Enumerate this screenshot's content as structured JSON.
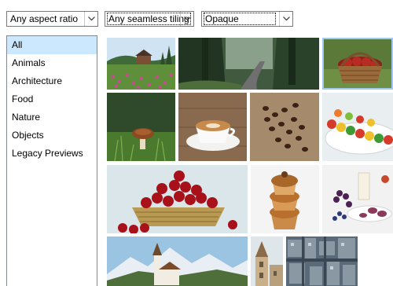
{
  "filters": {
    "aspect_ratio": {
      "selected": "Any aspect ratio"
    },
    "tiling": {
      "selected": "Any seamless tiling"
    },
    "opacity": {
      "selected": "Opaque"
    }
  },
  "categories": [
    {
      "label": "All",
      "selected": true
    },
    {
      "label": "Animals"
    },
    {
      "label": "Architecture"
    },
    {
      "label": "Food"
    },
    {
      "label": "Nature"
    },
    {
      "label": "Objects"
    },
    {
      "label": "Legacy Previews"
    }
  ],
  "thumbnails": [
    {
      "subject": "meadow-farmhouse"
    },
    {
      "subject": "forest-road"
    },
    {
      "subject": "apple-basket"
    },
    {
      "subject": "mushroom"
    },
    {
      "subject": "latte-cup"
    },
    {
      "subject": "coffee-beans"
    },
    {
      "subject": "vegetable-skewers"
    },
    {
      "subject": "cherry-basket"
    },
    {
      "subject": "muffin-stack"
    },
    {
      "subject": "breakfast-table"
    },
    {
      "subject": "alpine-church"
    },
    {
      "subject": "church-tower"
    },
    {
      "subject": "city-aerial"
    }
  ],
  "colors": {
    "selection": "#cce8ff",
    "border": "#828790",
    "combo_border": "#7a7a7a"
  }
}
